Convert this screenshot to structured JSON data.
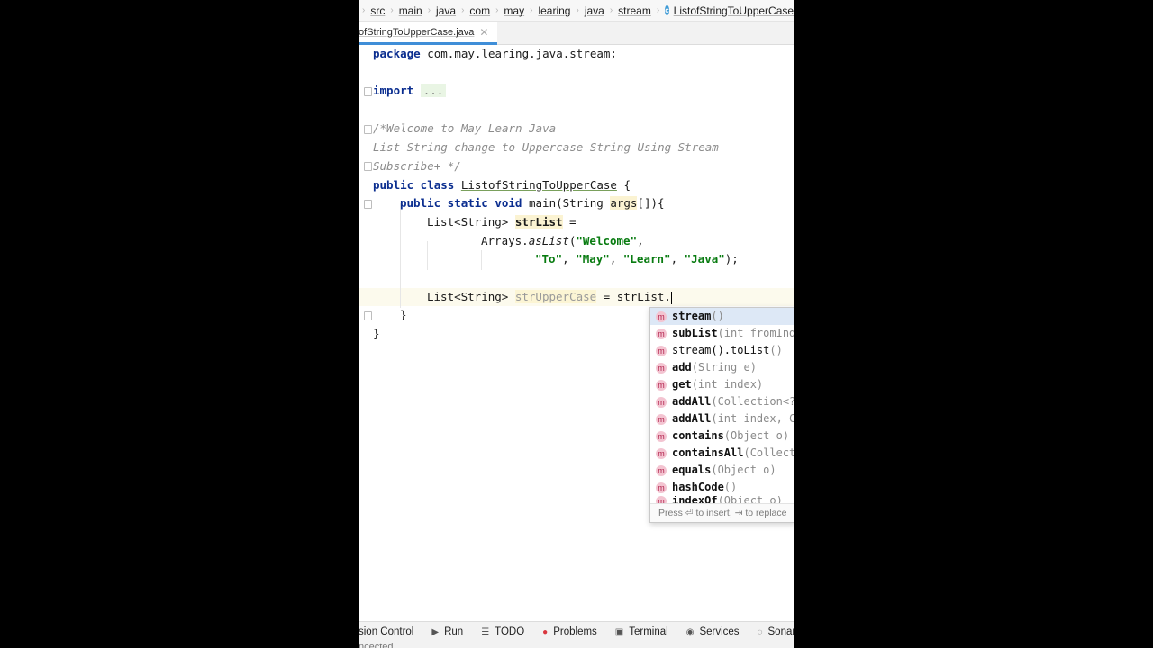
{
  "breadcrumb": {
    "items": [
      "src",
      "main",
      "java",
      "com",
      "may",
      "learing",
      "java",
      "stream"
    ],
    "current": "ListofStringToUpperCase"
  },
  "tab": {
    "label": "ofStringToUpperCase.java",
    "close": "✕"
  },
  "code": {
    "l1_kw": "package",
    "l1_rest": " com.may.learing.java.stream;",
    "l3_kw": "import",
    "l3_fold": "...",
    "l5": "/*Welcome to May Learn Java",
    "l6": "List String change to Uppercase String Using Stream",
    "l7": "Subscribe+ */",
    "l8_kw": "public class",
    "l8_name": "ListofStringToUpperCase",
    "l8_rest": " {",
    "l9_kw": "public static void",
    "l9_main": " main(String ",
    "l9_args": "args",
    "l9_rest": "[]){",
    "l10_type": "List<String> ",
    "l10_var": "strList",
    "l10_rest": " =",
    "l11_a": "Arrays.",
    "l11_fn": "asList",
    "l11_b": "(",
    "l11_s1": "\"Welcome\"",
    "l11_c": ",",
    "l12_s1": "\"To\"",
    "l12_s2": "\"May\"",
    "l12_s3": "\"Learn\"",
    "l12_s4": "\"Java\"",
    "l12_end": ");",
    "l14_type": "List<String> ",
    "l14_var": "strUpperCase",
    "l14_rest": " = strList.",
    "l15": "}",
    "l16": "}",
    "comma": ", "
  },
  "completion": {
    "items": [
      {
        "name": "stream",
        "sig": "()"
      },
      {
        "name": "subList",
        "sig": "(int fromIndex, int toIndex)"
      },
      {
        "name": "stream().toList",
        "sig": "()"
      },
      {
        "name": "add",
        "sig": "(String e)"
      },
      {
        "name": "get",
        "sig": "(int index)"
      },
      {
        "name": "addAll",
        "sig": "(Collection<? extends String> c)"
      },
      {
        "name": "addAll",
        "sig": "(int index, Collection c)"
      },
      {
        "name": "contains",
        "sig": "(Object o)"
      },
      {
        "name": "containsAll",
        "sig": "(Collection<?> c)"
      },
      {
        "name": "equals",
        "sig": "(Object o)"
      },
      {
        "name": "hashCode",
        "sig": "()"
      },
      {
        "name": "indexOf",
        "sig": "(Object o)"
      }
    ],
    "footer": "Press ⏎ to insert, ⇥ to replace"
  },
  "toolbar": {
    "version_control": "sion Control",
    "run": "Run",
    "todo": "TODO",
    "problems": "Problems",
    "terminal": "Terminal",
    "services": "Services",
    "sonarlint": "SonarLint"
  },
  "status": {
    "text": "ncected"
  },
  "colors": {
    "accent": "#3f8ed8",
    "keyword": "#0a2d8f",
    "string": "#087b10",
    "comment": "#8c8c8c"
  }
}
